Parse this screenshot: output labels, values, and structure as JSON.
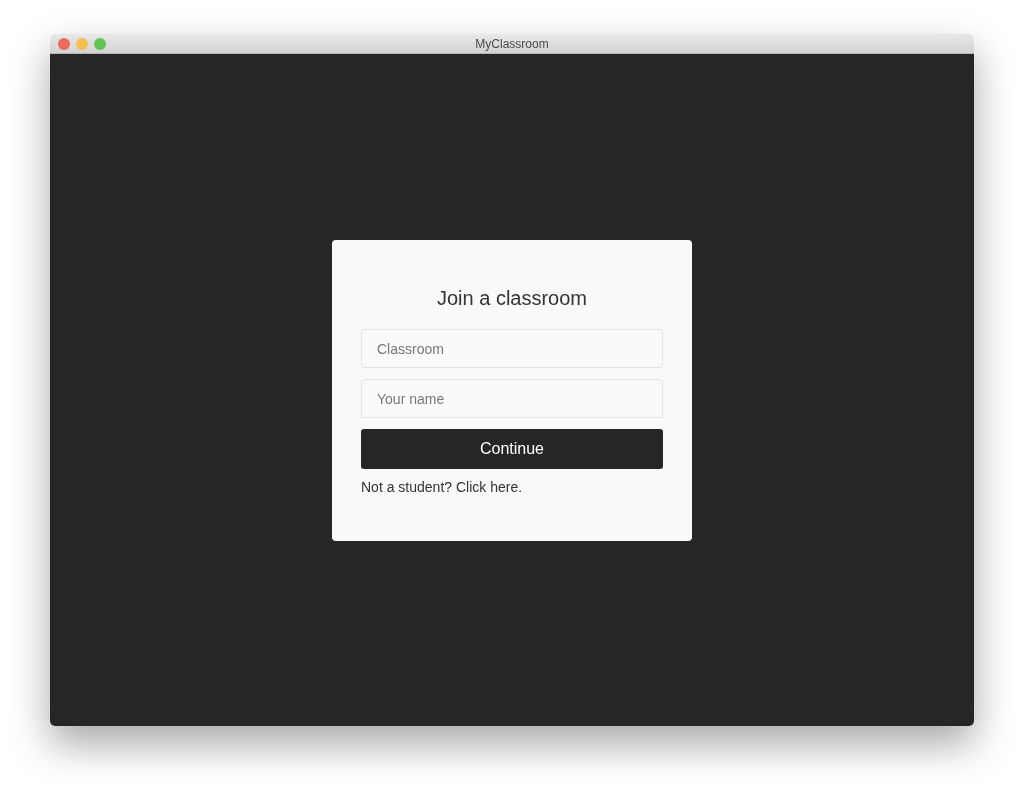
{
  "window": {
    "title": "MyClassroom"
  },
  "form": {
    "heading": "Join a classroom",
    "fields": [
      {
        "placeholder": "Classroom"
      },
      {
        "placeholder": "Your name"
      }
    ],
    "submit": "Continue",
    "footer_link": "Not a student? Click here."
  }
}
